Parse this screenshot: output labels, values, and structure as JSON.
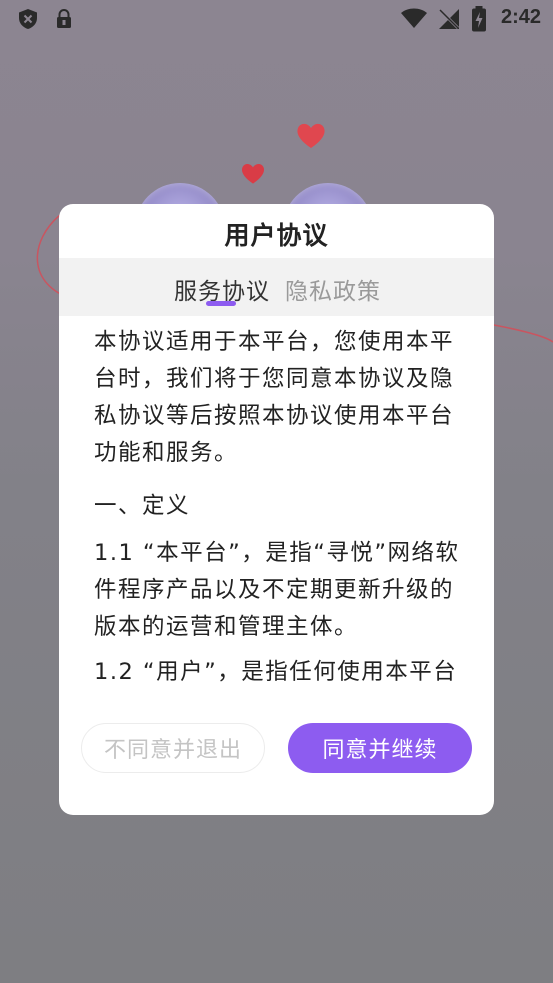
{
  "status_bar": {
    "time": "2:42",
    "icons": [
      "shield-icon",
      "lock-icon",
      "wifi-icon",
      "signal-off-icon",
      "battery-charging-icon"
    ]
  },
  "dialog": {
    "title": "用户协议",
    "tabs": [
      {
        "label": "服务协议",
        "active": true
      },
      {
        "label": "隐私政策",
        "active": false
      }
    ],
    "content": {
      "para1": "本协议适用于本平台，您使用本平台时，我们将于您同意本协议及隐私协议等后按照本协议使用本平台功能和服务。",
      "heading": "一、定义",
      "item1": "1.1 “本平台”，是指“寻悦”网络软件程序产品以及不定期更新升级的版本的运营和管理主体。",
      "item2": "1.2 “用户”，是指任何使用本平台"
    },
    "buttons": {
      "decline": "不同意并退出",
      "accept": "同意并继续"
    }
  },
  "colors": {
    "accent": "#8d5cf0",
    "heart": "#e0474f",
    "dialog_bg": "#ffffff",
    "tab_bar_bg": "#f2f2f2"
  }
}
